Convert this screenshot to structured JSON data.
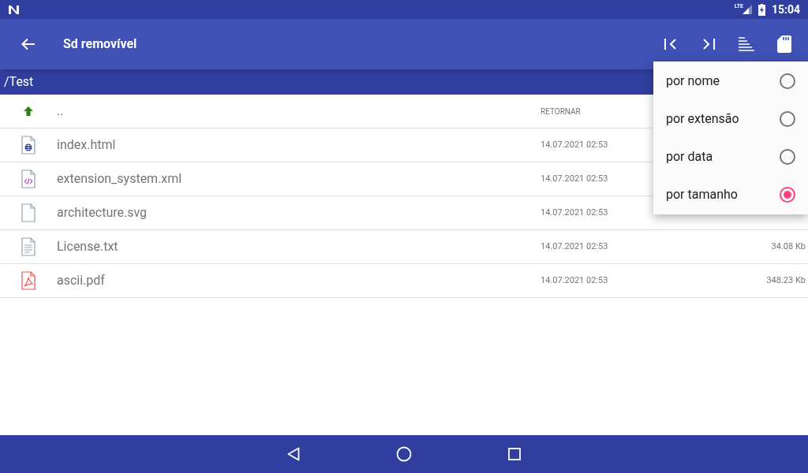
{
  "status_bar": {
    "network": "LTE",
    "time": "15:04"
  },
  "app_bar": {
    "title": "Sd removível"
  },
  "path": "/Test",
  "files": [
    {
      "kind": "up",
      "name": "..",
      "date": "RETORNAR"
    },
    {
      "kind": "html",
      "name": "index.html",
      "date": "14.07.2021 02:53"
    },
    {
      "kind": "xml",
      "name": "extension_system.xml",
      "date": "14.07.2021 02:53"
    },
    {
      "kind": "file",
      "name": "architecture.svg",
      "date": "14.07.2021 02:53"
    },
    {
      "kind": "text",
      "name": "License.txt",
      "date": "14.07.2021 02:53",
      "size": "34.08 Kb"
    },
    {
      "kind": "pdf",
      "name": "ascii.pdf",
      "date": "14.07.2021 02:53",
      "size": "348.23 Kb"
    }
  ],
  "sort_menu": [
    {
      "label": "por nome",
      "selected": false
    },
    {
      "label": "por extensão",
      "selected": false
    },
    {
      "label": "por data",
      "selected": false
    },
    {
      "label": "por tamanho",
      "selected": true
    }
  ]
}
